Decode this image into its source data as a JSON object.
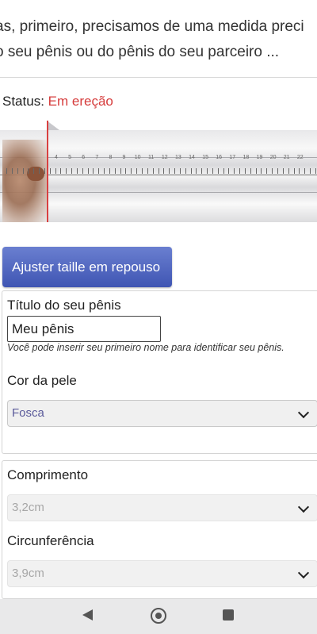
{
  "intro": {
    "line1": "as, primeiro, precisamos de uma medida preci",
    "line2": "o seu pênis ou do pênis do seu parceiro ..."
  },
  "status": {
    "label": "Status:",
    "value": "Em ereção",
    "value_color": "#d63c3c"
  },
  "ruler": {
    "tick_labels": [
      "4",
      "5",
      "6",
      "7",
      "8",
      "9",
      "10",
      "11",
      "12",
      "13",
      "14",
      "15",
      "16",
      "17",
      "18",
      "19",
      "20",
      "21",
      "22"
    ]
  },
  "buttons": {
    "adjust_label": "Ajuster taille em repouso"
  },
  "card1": {
    "title_label": "Título do seu pênis",
    "title_value": "Meu pênis",
    "hint": "Você pode inserir seu primeiro nome para identificar seu pênis.",
    "skin_label": "Cor da pele",
    "skin_value": "Fosca"
  },
  "card2": {
    "length_label": "Comprimento",
    "length_value": "3,2cm",
    "circ_label": "Circunferência",
    "circ_value": "3,9cm"
  },
  "colors": {
    "accent": "#3f55b3",
    "status": "#d63c3c"
  },
  "navbar": {
    "back": "back-icon",
    "home": "home-icon",
    "recent": "recent-apps-icon"
  }
}
